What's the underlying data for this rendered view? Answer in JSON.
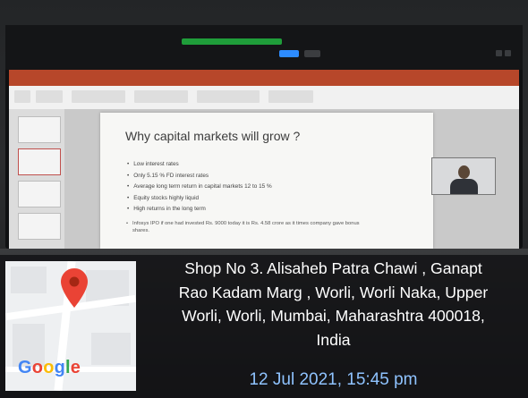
{
  "slide": {
    "title": "Why capital markets will grow ?",
    "bullets": [
      "Low interest rates",
      "Only 5.15 % FD interest rates",
      "Average long term return in capital markets 12 to 15 %",
      "Equity stocks highly liquid",
      "High returns in the long term"
    ],
    "note": "Infosys IPO if one had invested Rs. 9000 today it is Rs. 4.58 crore as it times company gave bonus shares."
  },
  "geotag": {
    "address_lines": [
      "Shop No 3. Alisaheb Patra Chawi , Ganapt",
      "Rao Kadam Marg , Worli, Worli Naka, Upper",
      "Worli, Worli, Mumbai, Maharashtra 400018,",
      "India"
    ],
    "datetime": "12 Jul 2021, 15:45 pm",
    "logo_text": "Google",
    "colors": {
      "datetime": "#8fc3ff",
      "pin": "#ea4335"
    }
  }
}
